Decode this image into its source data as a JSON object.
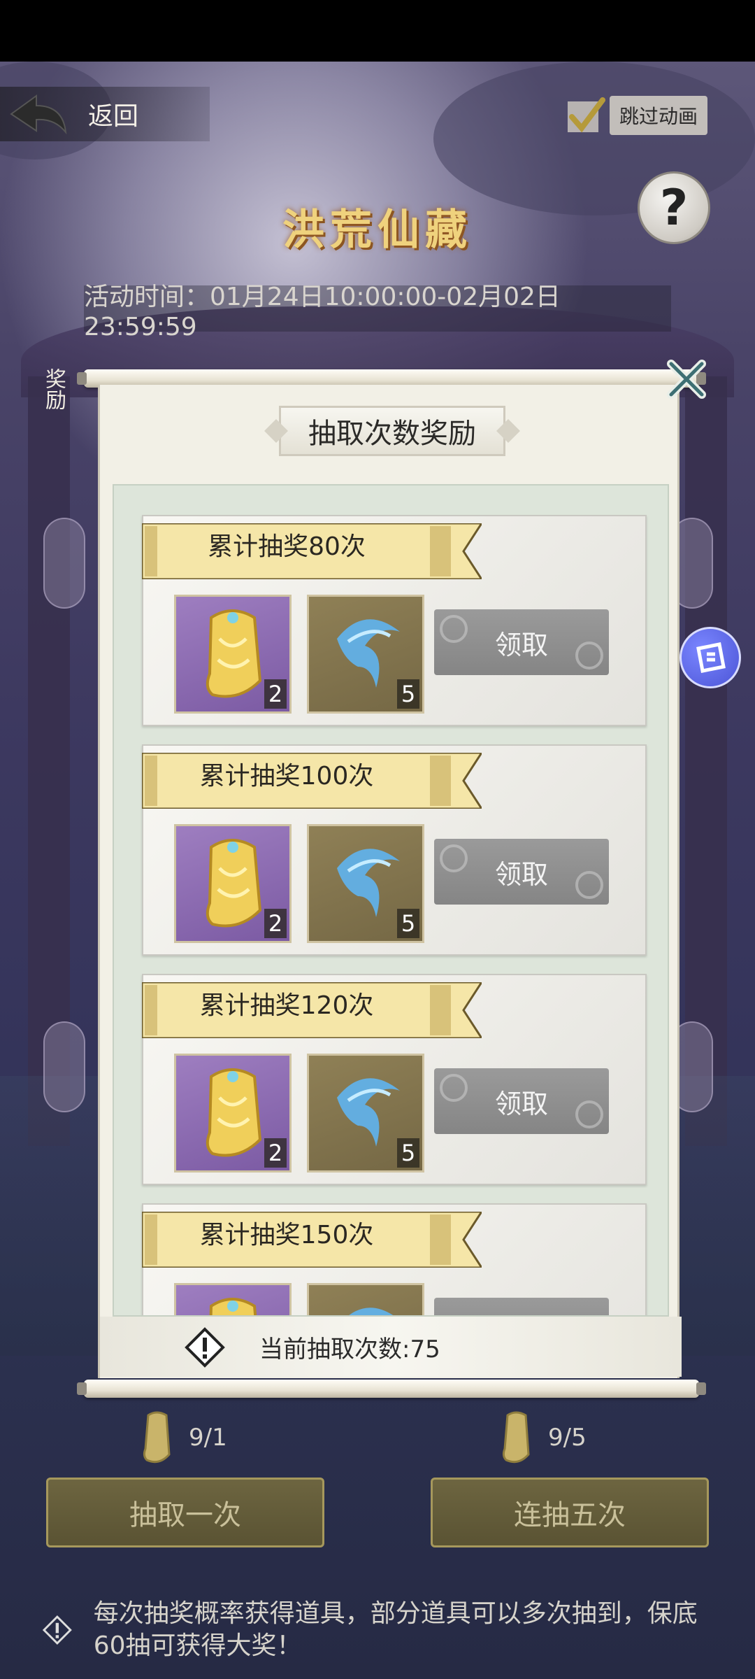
{
  "topbar": {
    "back_label": "返回",
    "skip_label": "跳过动画",
    "skip_checked": true
  },
  "page": {
    "title": "洪荒仙藏",
    "activity_time": "活动时间：01月24日10:00:00-02月02日23:59:59",
    "side_reward_label": "奖励"
  },
  "modal": {
    "title": "抽取次数奖励",
    "rewards": [
      {
        "milestone": "累计抽奖80次",
        "item1_count": "2",
        "item2_count": "5",
        "claim_label": "领取"
      },
      {
        "milestone": "累计抽奖100次",
        "item1_count": "2",
        "item2_count": "5",
        "claim_label": "领取"
      },
      {
        "milestone": "累计抽奖120次",
        "item1_count": "2",
        "item2_count": "5",
        "claim_label": "领取"
      },
      {
        "milestone": "累计抽奖150次",
        "claim_label": "领取"
      }
    ],
    "current_count": "当前抽取次数:75"
  },
  "draw": {
    "single_cost": "9/1",
    "single_label": "抽取一次",
    "five_cost": "9/5",
    "five_label": "连抽五次"
  },
  "notice": "每次抽奖概率获得道具，部分道具可以多次抽到，保底60抽可获得大奖！",
  "colors": {
    "claim_button": "#8f8f8f",
    "banner": "#f5e6a8",
    "item_purple": "#8d6db3",
    "item_olive": "#837450",
    "title_gold": "#efd27d"
  }
}
